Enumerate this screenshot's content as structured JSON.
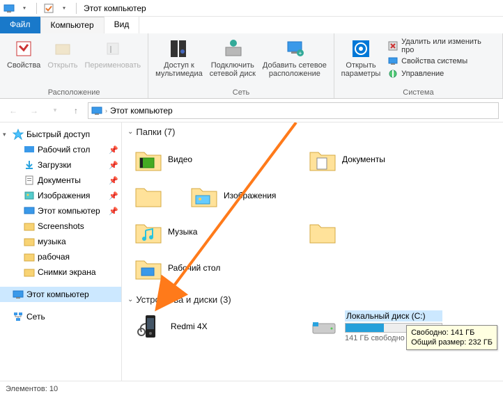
{
  "title": "Этот компьютер",
  "tabs": {
    "file": "Файл",
    "computer": "Компьютер",
    "view": "Вид"
  },
  "ribbon": {
    "properties": "Свойства",
    "open": "Открыть",
    "rename": "Переименовать",
    "location_group": "Расположение",
    "media": "Доступ к\nмультимедиа",
    "netdrive": "Подключить\nсетевой диск",
    "netloc": "Добавить сетевое\nрасположение",
    "network_group": "Сеть",
    "settings": "Открыть\nпараметры",
    "uninstall": "Удалить или изменить про",
    "sysprops": "Свойства системы",
    "manage": "Управление",
    "system_group": "Система"
  },
  "breadcrumb": "Этот компьютер",
  "sidebar": {
    "quick": "Быстрый доступ",
    "items": [
      {
        "label": "Рабочий стол",
        "pin": true
      },
      {
        "label": "Загрузки",
        "pin": true
      },
      {
        "label": "Документы",
        "pin": true
      },
      {
        "label": "Изображения",
        "pin": true
      },
      {
        "label": "Этот компьютер",
        "pin": true
      },
      {
        "label": "Screenshots",
        "pin": false
      },
      {
        "label": "музыка",
        "pin": false
      },
      {
        "label": "рабочая",
        "pin": false
      },
      {
        "label": "Снимки экрана",
        "pin": false
      }
    ],
    "thispc": "Этот компьютер",
    "network": "Сеть"
  },
  "sections": {
    "folders": "Папки (7)",
    "devices": "Устройства и диски (3)"
  },
  "folders": [
    {
      "label": "Видео",
      "kind": "video"
    },
    {
      "label": "Документы",
      "kind": "docs"
    },
    {
      "label": "Изображения",
      "kind": "images"
    },
    {
      "label": "Музыка",
      "kind": "music"
    },
    {
      "label": "Рабочий стол",
      "kind": "desktop"
    }
  ],
  "devices": {
    "phone": "Redmi 4X",
    "disk_name": "Локальный диск (C:)",
    "disk_free": "141 ГБ свободно"
  },
  "tooltip": {
    "line1": "Свободно: 141 ГБ",
    "line2": "Общий размер: 232 ГБ"
  },
  "status": "Элементов: 10"
}
